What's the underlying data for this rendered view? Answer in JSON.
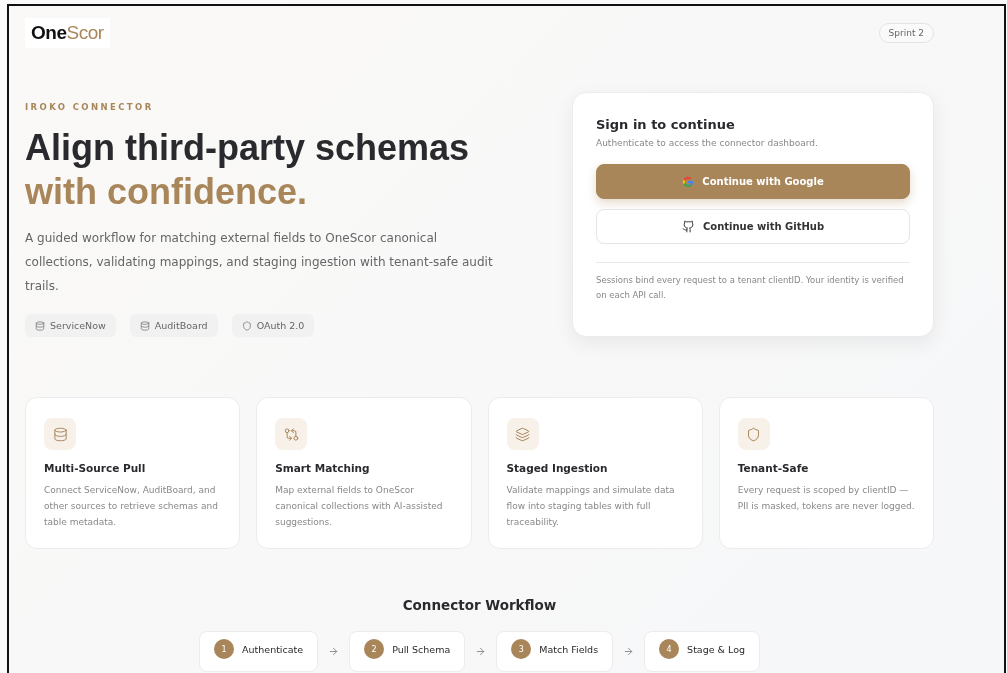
{
  "header": {
    "logo": {
      "part_1": "One",
      "part_2": "Scor"
    },
    "badge": "Sprint 2"
  },
  "hero": {
    "eyebrow": "IROKO CONNECTOR",
    "title_line_1": "Align third-party schemas",
    "title_line_2": "with confidence.",
    "description": "A guided workflow for matching external fields to OneScor canonical collections, validating mappings, and staging ingestion with tenant-safe audit trails.",
    "chips": [
      {
        "label": "ServiceNow",
        "kind": "database"
      },
      {
        "label": "AuditBoard",
        "kind": "database"
      },
      {
        "label": "OAuth 2.0",
        "kind": "shield"
      }
    ]
  },
  "sign_in": {
    "title": "Sign in to continue",
    "subtitle": "Authenticate to access the connector dashboard.",
    "buttons": [
      {
        "label": "Continue with Google",
        "kind": "google"
      },
      {
        "label": "Continue with GitHub",
        "kind": "github"
      }
    ],
    "note": "Sessions bind every request to a tenant clientID. Your identity is verified on each API call."
  },
  "features": [
    {
      "kind": "database",
      "title": "Multi-Source Pull",
      "text": "Connect ServiceNow, AuditBoard, and other sources to retrieve schemas and table metadata."
    },
    {
      "kind": "compare",
      "title": "Smart Matching",
      "text": "Map external fields to OneScor canonical collections with AI-assisted suggestions."
    },
    {
      "kind": "layers",
      "title": "Staged Ingestion",
      "text": "Validate mappings and simulate data flow into staging tables with full traceability."
    },
    {
      "kind": "shield",
      "title": "Tenant-Safe",
      "text": "Every request is scoped by clientID — PII is masked, tokens are never logged."
    }
  ],
  "workflow": {
    "title": "Connector Workflow",
    "steps": [
      {
        "number": "1",
        "label": "Authenticate"
      },
      {
        "number": "2",
        "label": "Pull Schema"
      },
      {
        "number": "3",
        "label": "Match Fields"
      },
      {
        "number": "4",
        "label": "Stage & Log"
      }
    ]
  }
}
